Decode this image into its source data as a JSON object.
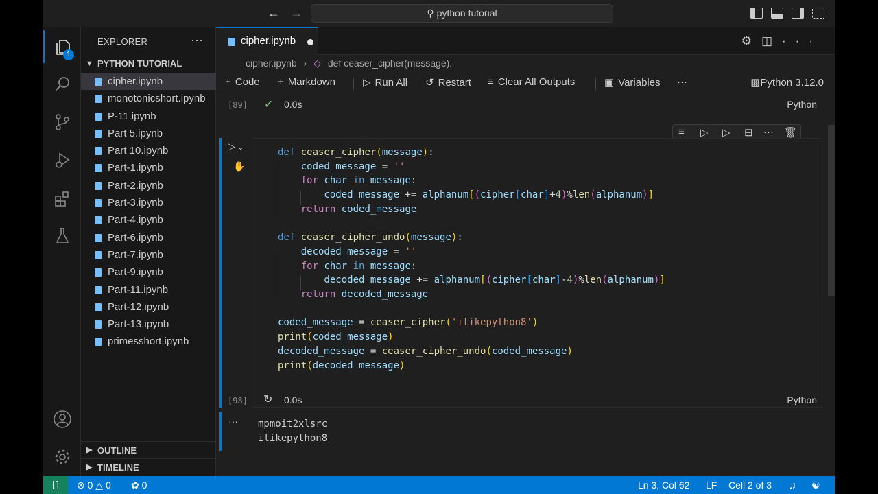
{
  "titlebar": {
    "search_text": "python tutorial"
  },
  "activity_bar": {
    "explorer_badge": "1"
  },
  "sidebar": {
    "title": "EXPLORER",
    "more": "···",
    "folder": "PYTHON TUTORIAL",
    "files": [
      "cipher.ipynb",
      "monotonicshort.ipynb",
      "P-11.ipynb",
      "Part 5.ipynb",
      "Part 10.ipynb",
      "Part-1.ipynb",
      "Part-2.ipynb",
      "Part-3.ipynb",
      "Part-4.ipynb",
      "Part-6.ipynb",
      "Part-7.ipynb",
      "Part-9.ipynb",
      "Part-11.ipynb",
      "Part-12.ipynb",
      "Part-13.ipynb",
      "primesshort.ipynb"
    ],
    "active_file_index": 0,
    "outline_label": "OUTLINE",
    "timeline_label": "TIMELINE"
  },
  "editor": {
    "tab_label": "cipher.ipynb",
    "breadcrumb": {
      "file": "cipher.ipynb",
      "sep": "›",
      "symbol": "def ceaser_cipher(message):"
    },
    "toolbar": {
      "code": "Code",
      "markdown": "Markdown",
      "run_all": "Run All",
      "restart": "Restart",
      "clear_outputs": "Clear All Outputs",
      "variables": "Variables",
      "more": "···",
      "kernel": "Python 3.12.0"
    },
    "prev_cell": {
      "exec_count": "[89]",
      "time": "0.0s",
      "language": "Python"
    },
    "current_cell": {
      "exec_count": "[98]",
      "time": "0.0s",
      "language": "Python"
    },
    "output_lines": [
      "mpmoit2xlsrc",
      "ilikepython8"
    ],
    "output_more": "···"
  },
  "statusbar": {
    "errors": "0",
    "warnings": "0",
    "ports": "0",
    "cursor": "Ln 3, Col 62",
    "eol": "LF",
    "cell": "Cell 2 of 3"
  },
  "colors": {
    "accent": "#0078d4",
    "remote": "#16825d",
    "background": "#1f1f1f"
  }
}
